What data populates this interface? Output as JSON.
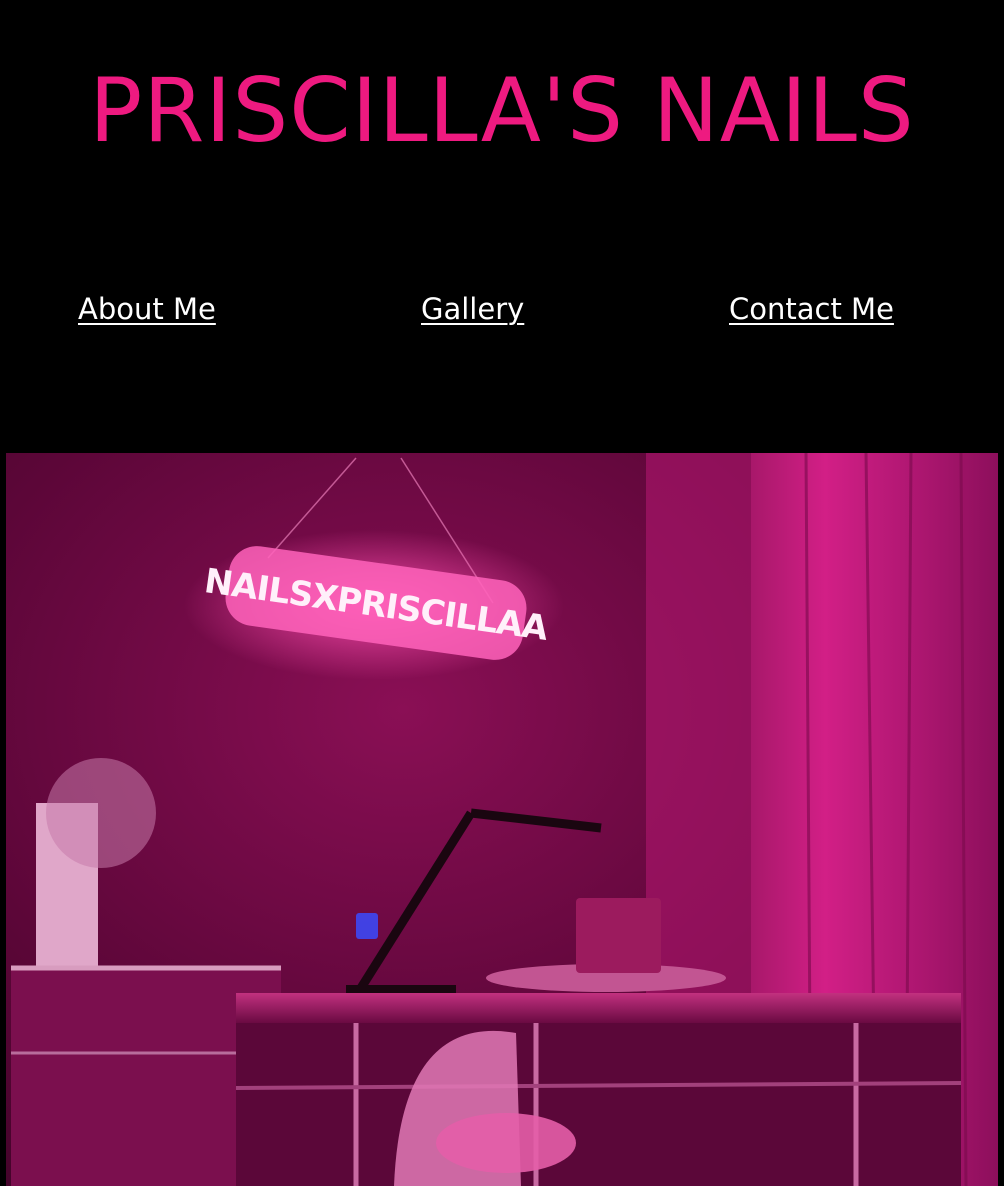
{
  "header": {
    "title": "PRISCILLA'S NAILS"
  },
  "nav": {
    "items": [
      {
        "label": "About Me"
      },
      {
        "label": "Gallery"
      },
      {
        "label": "Contact Me"
      }
    ]
  },
  "hero": {
    "neon_sign_text": "NAILSXPRISCILLAA"
  },
  "colors": {
    "background": "#000000",
    "accent": "#ee1a80",
    "nav_text": "#ffffff",
    "photo_tint": "#8a0f55"
  }
}
